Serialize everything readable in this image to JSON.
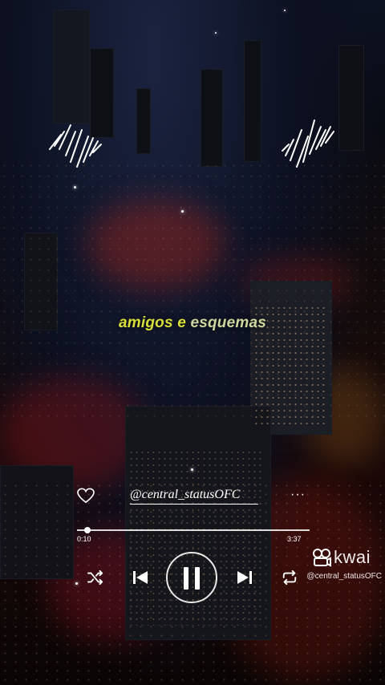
{
  "lyric": {
    "word1": "amigos e",
    "word2": "esquemas"
  },
  "profile": {
    "handle": "@central_statusOFC",
    "more_label": "···"
  },
  "player": {
    "current_time": "0:10",
    "total_time": "3:37",
    "progress": 0.046
  },
  "branding": {
    "app_name": "kwai",
    "watermark": "@central_statusOFC"
  },
  "colors": {
    "lyric_accent": "#d8df3a",
    "lyric_secondary": "#cfd7a0"
  },
  "icons": {
    "like": "heart-outline-icon",
    "shuffle": "shuffle-icon",
    "previous": "skip-previous-icon",
    "play_pause": "pause-icon",
    "next": "skip-next-icon",
    "repeat": "repeat-icon",
    "waveform": "sound-wave-icon"
  }
}
